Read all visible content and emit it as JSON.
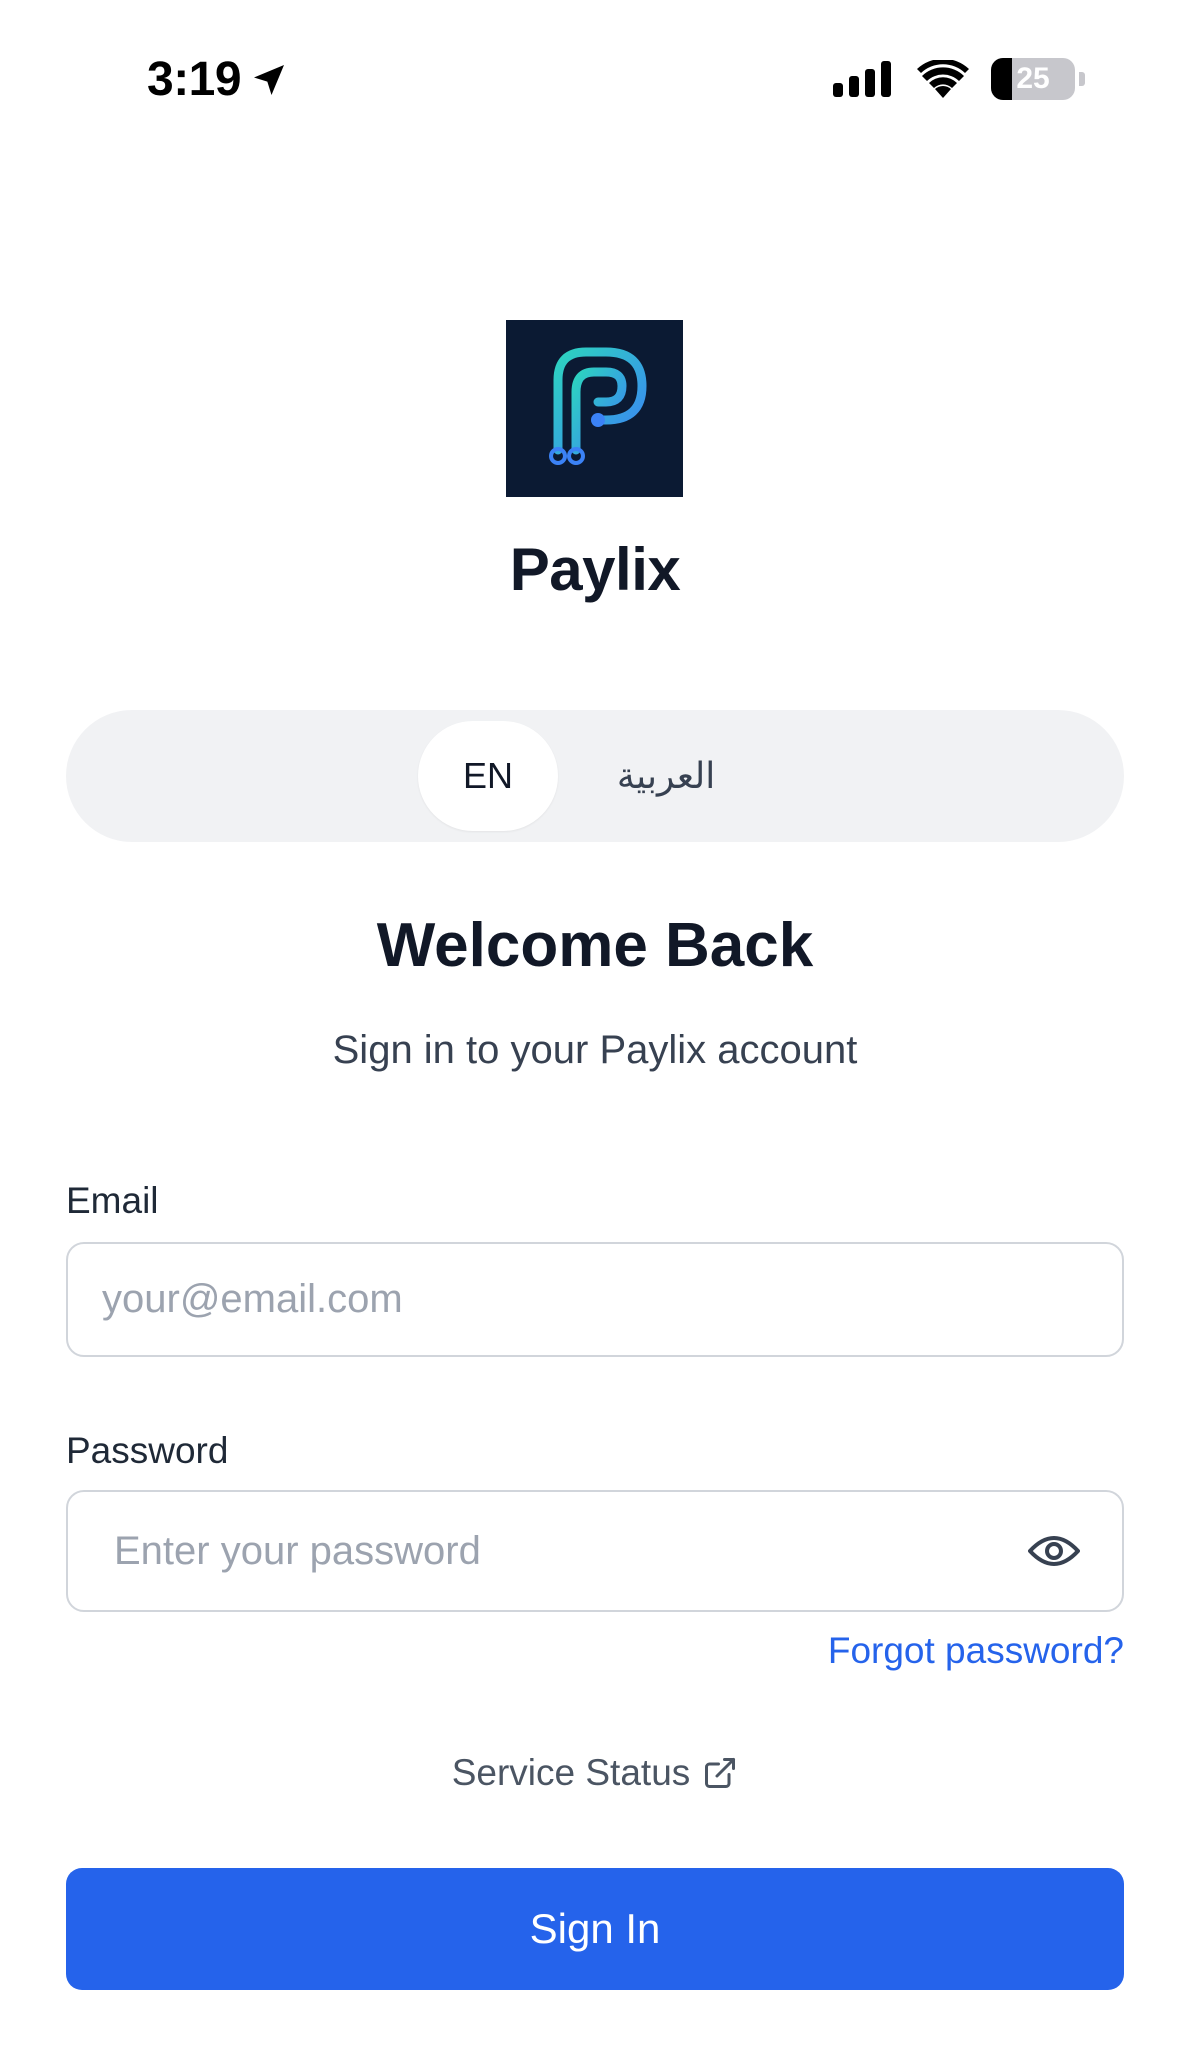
{
  "status_bar": {
    "time": "3:19",
    "battery_level": "25",
    "battery_fraction": 0.25,
    "icons": [
      "location-arrow-icon",
      "cellular-signal-icon",
      "wifi-icon",
      "battery-icon"
    ]
  },
  "brand": {
    "name": "Paylix",
    "logo_icon": "paylix-logo-icon",
    "logo_bg": "#0b1a33",
    "logo_gradient": [
      "#2dd4bf",
      "#3b82f6"
    ]
  },
  "language_toggle": {
    "options": [
      {
        "label": "EN",
        "active": true
      },
      {
        "label": "العربية",
        "active": false
      }
    ]
  },
  "header": {
    "title": "Welcome Back",
    "subtitle": "Sign in to your Paylix account"
  },
  "form": {
    "email": {
      "label": "Email",
      "placeholder": "your@email.com",
      "value": ""
    },
    "password": {
      "label": "Password",
      "placeholder": "Enter your password",
      "value": "",
      "toggle_icon": "eye-icon"
    },
    "forgot_password": "Forgot password?",
    "service_status": "Service Status",
    "service_status_icon": "external-link-icon",
    "submit_label": "Sign In"
  },
  "colors": {
    "primary": "#2563eb",
    "link": "#2563eb",
    "toggle_bg": "#f1f2f4",
    "text_dark": "#111827",
    "text_muted": "#374151",
    "placeholder": "#9ca3af",
    "border": "#d1d5db"
  }
}
